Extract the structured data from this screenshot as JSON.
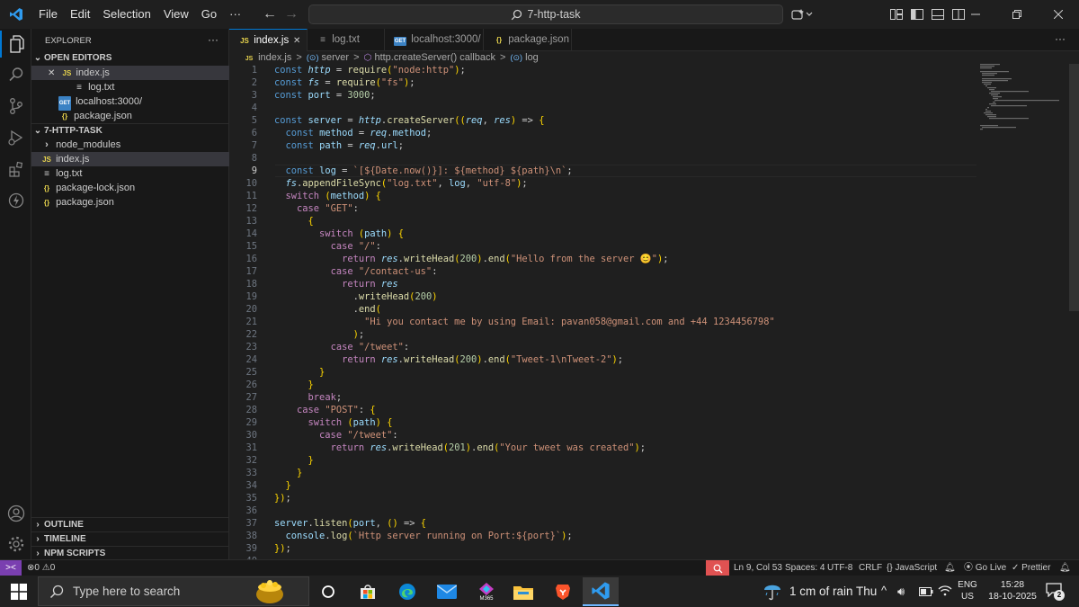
{
  "titlebar": {
    "menu": [
      "File",
      "Edit",
      "Selection",
      "View",
      "Go",
      "···"
    ],
    "search_text": "7-http-task"
  },
  "sidebar": {
    "title": "EXPLORER",
    "more": "···",
    "open_editors_header": "OPEN EDITORS",
    "open_editors": [
      {
        "icon": "JS",
        "label": "index.js",
        "close": "✕"
      },
      {
        "icon": "≡",
        "label": "log.txt"
      },
      {
        "icon": "GET",
        "label": "localhost:3000/"
      },
      {
        "icon": "{}",
        "label": "package.json"
      }
    ],
    "project_header": "7-HTTP-TASK",
    "files": [
      {
        "icon": "›",
        "label": "node_modules"
      },
      {
        "icon": "JS",
        "label": "index.js"
      },
      {
        "icon": "≡",
        "label": "log.txt"
      },
      {
        "icon": "{}",
        "label": "package-lock.json"
      },
      {
        "icon": "{}",
        "label": "package.json"
      }
    ],
    "outline": "OUTLINE",
    "timeline": "TIMELINE",
    "npm_scripts": "NPM SCRIPTS"
  },
  "tabs": [
    {
      "icon": "JS",
      "label": "index.js",
      "close": "✕"
    },
    {
      "icon": "≡",
      "label": "log.txt"
    },
    {
      "icon": "GET",
      "label": "localhost:3000/"
    },
    {
      "icon": "{}",
      "label": "package.json"
    }
  ],
  "tabbar_more": "···",
  "breadcrumb": {
    "file_icon": "JS",
    "file": "index.js",
    "sep": ">",
    "server": "server",
    "callback": "http.createServer() callback",
    "log": "log"
  },
  "editor": {
    "current_line": 9,
    "code": [
      "const http = require(\"node:http\");",
      "const fs = require(\"fs\");",
      "const port = 3000;",
      "",
      "const server = http.createServer((req, res) => {",
      "  const method = req.method;",
      "  const path = req.url;",
      "",
      "  const log = `[${Date.now()}]: ${method} ${path}\\n`;",
      "  fs.appendFileSync(\"log.txt\", log, \"utf-8\");",
      "  switch (method) {",
      "    case \"GET\":",
      "      {",
      "        switch (path) {",
      "          case \"/\":",
      "            return res.writeHead(200).end(\"Hello from the server 😊\");",
      "          case \"/contact-us\":",
      "            return res",
      "              .writeHead(200)",
      "              .end(",
      "                \"Hi you contact me by using Email: pavan058@gmail.com and +44 1234456798\"",
      "              );",
      "          case \"/tweet\":",
      "            return res.writeHead(200).end(\"Tweet-1\\nTweet-2\");",
      "        }",
      "      }",
      "      break;",
      "    case \"POST\": {",
      "      switch (path) {",
      "        case \"/tweet\":",
      "          return res.writeHead(201).end(\"Your tweet was created\");",
      "      }",
      "    }",
      "  }",
      "});",
      "",
      "server.listen(port, () => {",
      "  console.log(`Http server running on Port:${port}`);",
      "});",
      ""
    ]
  },
  "statusbar": {
    "remote": "><",
    "errors": "0",
    "warnings": "0",
    "position": "Ln 9, Col 53",
    "spaces": "Spaces: 4",
    "encoding": "UTF-8",
    "eol": "CRLF",
    "language": "JavaScript",
    "lang_prefix": "{}",
    "golive": "Go Live",
    "prettier": "Prettier"
  },
  "taskbar": {
    "search_placeholder": "Type here to search",
    "weather": "1 cm of rain Thu",
    "lang_top": "ENG",
    "lang_bottom": "US",
    "time": "15:28",
    "date": "18-10-2025",
    "notifications": "2",
    "m365": "M365"
  },
  "colors": {
    "accent": "#0078d4",
    "keyword": "#569cd6",
    "function": "#dcdcaa",
    "string": "#ce9178",
    "number": "#b5cea8",
    "control": "#c586c0"
  }
}
